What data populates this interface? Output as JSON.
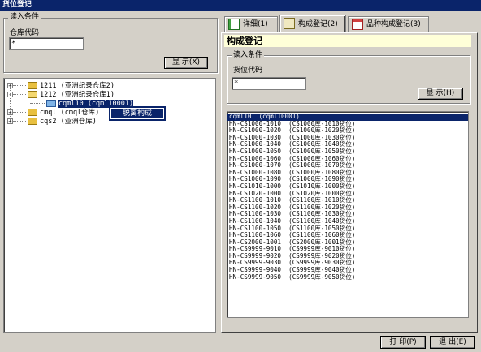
{
  "window": {
    "title": "货位登记"
  },
  "left": {
    "group_title": "读入条件",
    "field_label": "仓库代码",
    "field_value": "*",
    "display_button": "显 示(X)",
    "tree": [
      {
        "label": "1211  (亚洲纪录仓库2)",
        "expander": "+"
      },
      {
        "label": "1212  (亚洲纪录仓库1)",
        "expander": "-"
      },
      {
        "label": "cqml10  (cqml10001)"
      },
      {
        "label": "cmql  (cmql仓库)",
        "expander": "+"
      },
      {
        "label": "cqs2  (亚洲仓库)",
        "expander": "+"
      }
    ],
    "context_menu": {
      "item": "脱离构成"
    }
  },
  "tabs": [
    {
      "label": "详细(1)",
      "icon": "book-icon"
    },
    {
      "label": "构成登记(2)",
      "icon": "notebook-icon"
    },
    {
      "label": "品种构成登记(3)",
      "icon": "form-icon"
    }
  ],
  "right": {
    "section_title": "构成登记",
    "group_title": "读入条件",
    "field_label": "货位代码",
    "field_value": "*",
    "display_button": "显 示(H)",
    "list": [
      "cqml10  (cqml10001)",
      "HN-CS1000-1010  (CS1000库-1010货位)",
      "HN-CS1000-1020  (CS1000库-1020货位)",
      "HN-CS1000-1030  (CS1000库-1030货位)",
      "HN-CS1000-1040  (CS1000库-1040货位)",
      "HN-CS1000-1050  (CS1000库-1050货位)",
      "HN-CS1000-1060  (CS1000库-1060货位)",
      "HN-CS1000-1070  (CS1000库-1070货位)",
      "HN-CS1000-1080  (CS1000库-1080货位)",
      "HN-CS1000-1090  (CS1000库-1090货位)",
      "HN-CS1010-1000  (CS1010库-1000货位)",
      "HN-CS1020-1000  (CS1020库-1000货位)",
      "HN-CS1100-1010  (CS1100库-1010货位)",
      "HN-CS1100-1020  (CS1100库-1020货位)",
      "HN-CS1100-1030  (CS1100库-1030货位)",
      "HN-CS1100-1040  (CS1100库-1040货位)",
      "HN-CS1100-1050  (CS1100库-1050货位)",
      "HN-CS1100-1060  (CS1100库-1060货位)",
      "HN-CS2000-1001  (CS2000库-1001货位)",
      "HN-CS9999-9010  (CS9999库-9010货位)",
      "HN-CS9999-9020  (CS9999库-9020货位)",
      "HN-CS9999-9030  (CS9999库-9030货位)",
      "HN-CS9999-9040  (CS9999库-9040货位)",
      "HN-CS9999-9050  (CS9999库-9050货位)"
    ]
  },
  "footer": {
    "print_button": "打 印(P)",
    "exit_button": "退 出(E)"
  }
}
